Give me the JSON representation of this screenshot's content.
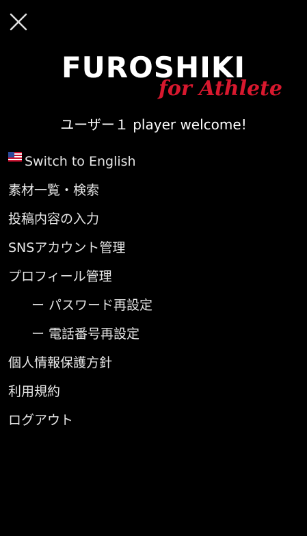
{
  "header": {
    "close_icon": "close-icon"
  },
  "logo": {
    "main": "FUROSHIKI",
    "sub": "for Athlete",
    "accent_color": "#d8182e"
  },
  "welcome": {
    "text": "ユーザー１ player welcome!"
  },
  "menu": {
    "language": {
      "icon": "us-flag-icon",
      "label": "Switch to English"
    },
    "items": [
      {
        "label": "素材一覧・検索"
      },
      {
        "label": "投稿内容の入力"
      },
      {
        "label": "SNSアカウント管理"
      },
      {
        "label": "プロフィール管理"
      }
    ],
    "subitems": [
      {
        "dash": "ー",
        "label": "パスワード再設定"
      },
      {
        "dash": "ー",
        "label": "電話番号再設定"
      }
    ],
    "items_after": [
      {
        "label": "個人情報保護方針"
      },
      {
        "label": "利用規約"
      },
      {
        "label": "ログアウト"
      }
    ]
  }
}
